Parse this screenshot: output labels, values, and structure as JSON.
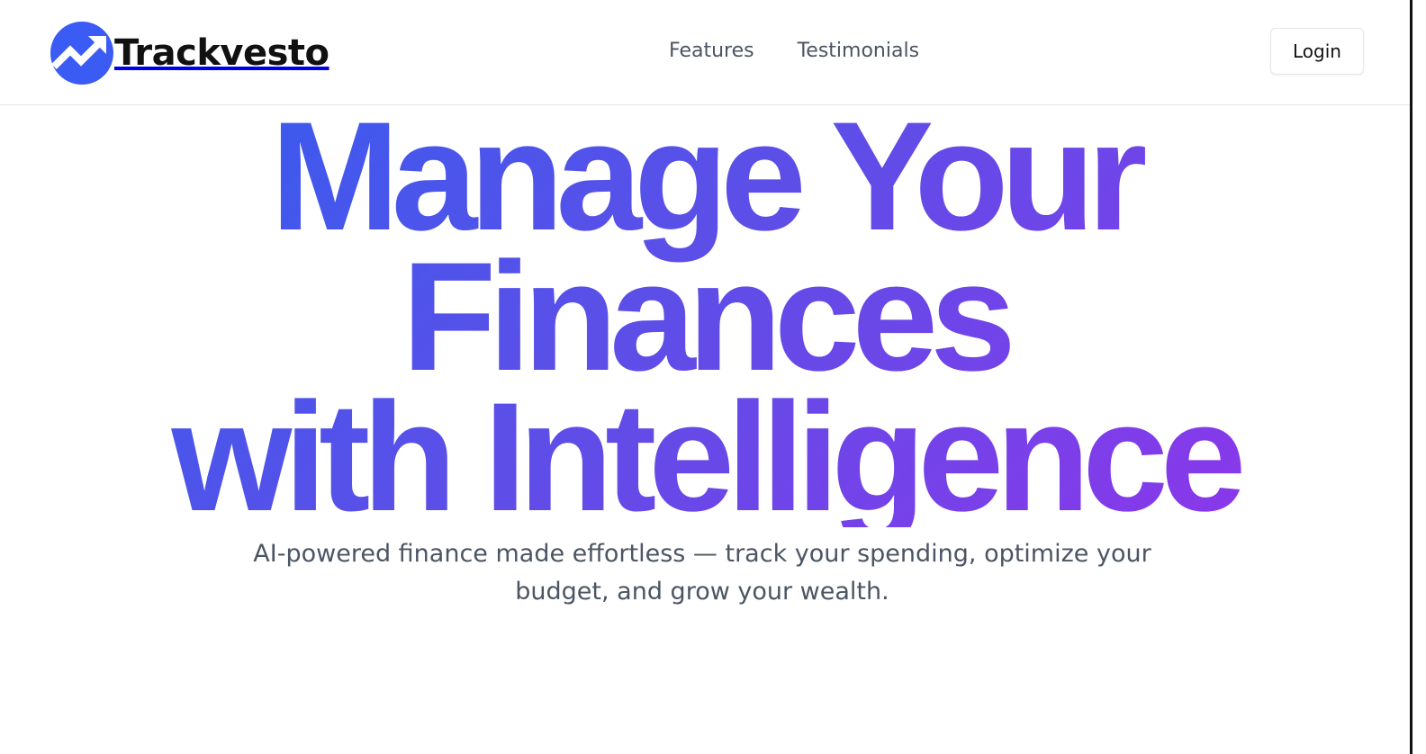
{
  "header": {
    "brand_name": "Trackvesto",
    "nav": [
      {
        "label": "Features"
      },
      {
        "label": "Testimonials"
      }
    ],
    "login_label": "Login"
  },
  "hero": {
    "title_lines": [
      "Manage Your",
      "Finances",
      "with Intelligence"
    ],
    "subtitle": "AI-powered finance made effortless — track your spending, optimize your budget, and grow your wealth."
  },
  "colors": {
    "brand_blue": "#3b5bf5",
    "gradient_start": "#2f5ff0",
    "gradient_end": "#9333ea",
    "text_muted": "#4b5563"
  },
  "icons": {
    "brand_logo": "trending-up-icon"
  }
}
